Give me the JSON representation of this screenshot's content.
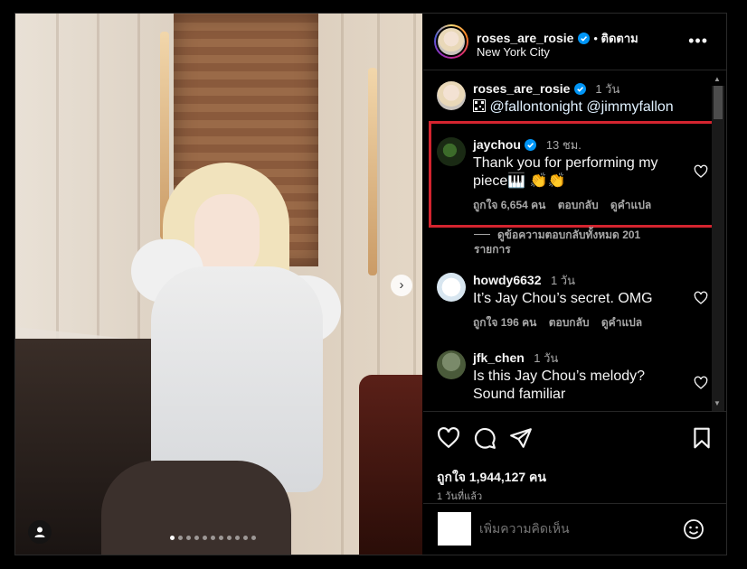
{
  "header": {
    "username": "roses_are_rosie",
    "follow_label": "ติดตาม",
    "location": "New York City",
    "more_icon": "more-horizontal-icon"
  },
  "comments": [
    {
      "username": "roses_are_rosie",
      "time": "1 วัน",
      "text": "@fallontonight @jimmyfallon",
      "caption_icon": "qr-code-icon"
    },
    {
      "username": "jaychou",
      "time": "13 ชม.",
      "text": "Thank you for performing my piece🎹 👏👏",
      "likes": "ถูกใจ 6,654 คน",
      "reply": "ตอบกลับ",
      "translate": "ดูคำแปล",
      "view_replies": "ดูข้อความตอบกลับทั้งหมด 201 รายการ",
      "highlighted": true
    },
    {
      "username": "howdy6632",
      "time": "1 วัน",
      "text": "It’s Jay Chou’s secret. OMG",
      "likes": "ถูกใจ 196 คน",
      "reply": "ตอบกลับ",
      "translate": "ดูคำแปล"
    },
    {
      "username": "jfk_chen",
      "time": "1 วัน",
      "text": "Is this Jay Chou’s melody? Sound familiar"
    }
  ],
  "actions": {
    "like_icon": "heart-icon",
    "comment_icon": "comment-icon",
    "share_icon": "send-icon",
    "save_icon": "bookmark-icon"
  },
  "post": {
    "likes": "ถูกใจ 1,944,127 คน",
    "time": "1 วันที่แล้ว",
    "carousel_position": 1,
    "carousel_count": 11
  },
  "add_comment": {
    "placeholder": "เพิ่มความคิดเห็น"
  },
  "colors": {
    "background": "#000000",
    "text": "#f5f5f5",
    "muted": "#a8a8a8",
    "highlight_box": "#d4242f",
    "verified": "#0095f6"
  }
}
